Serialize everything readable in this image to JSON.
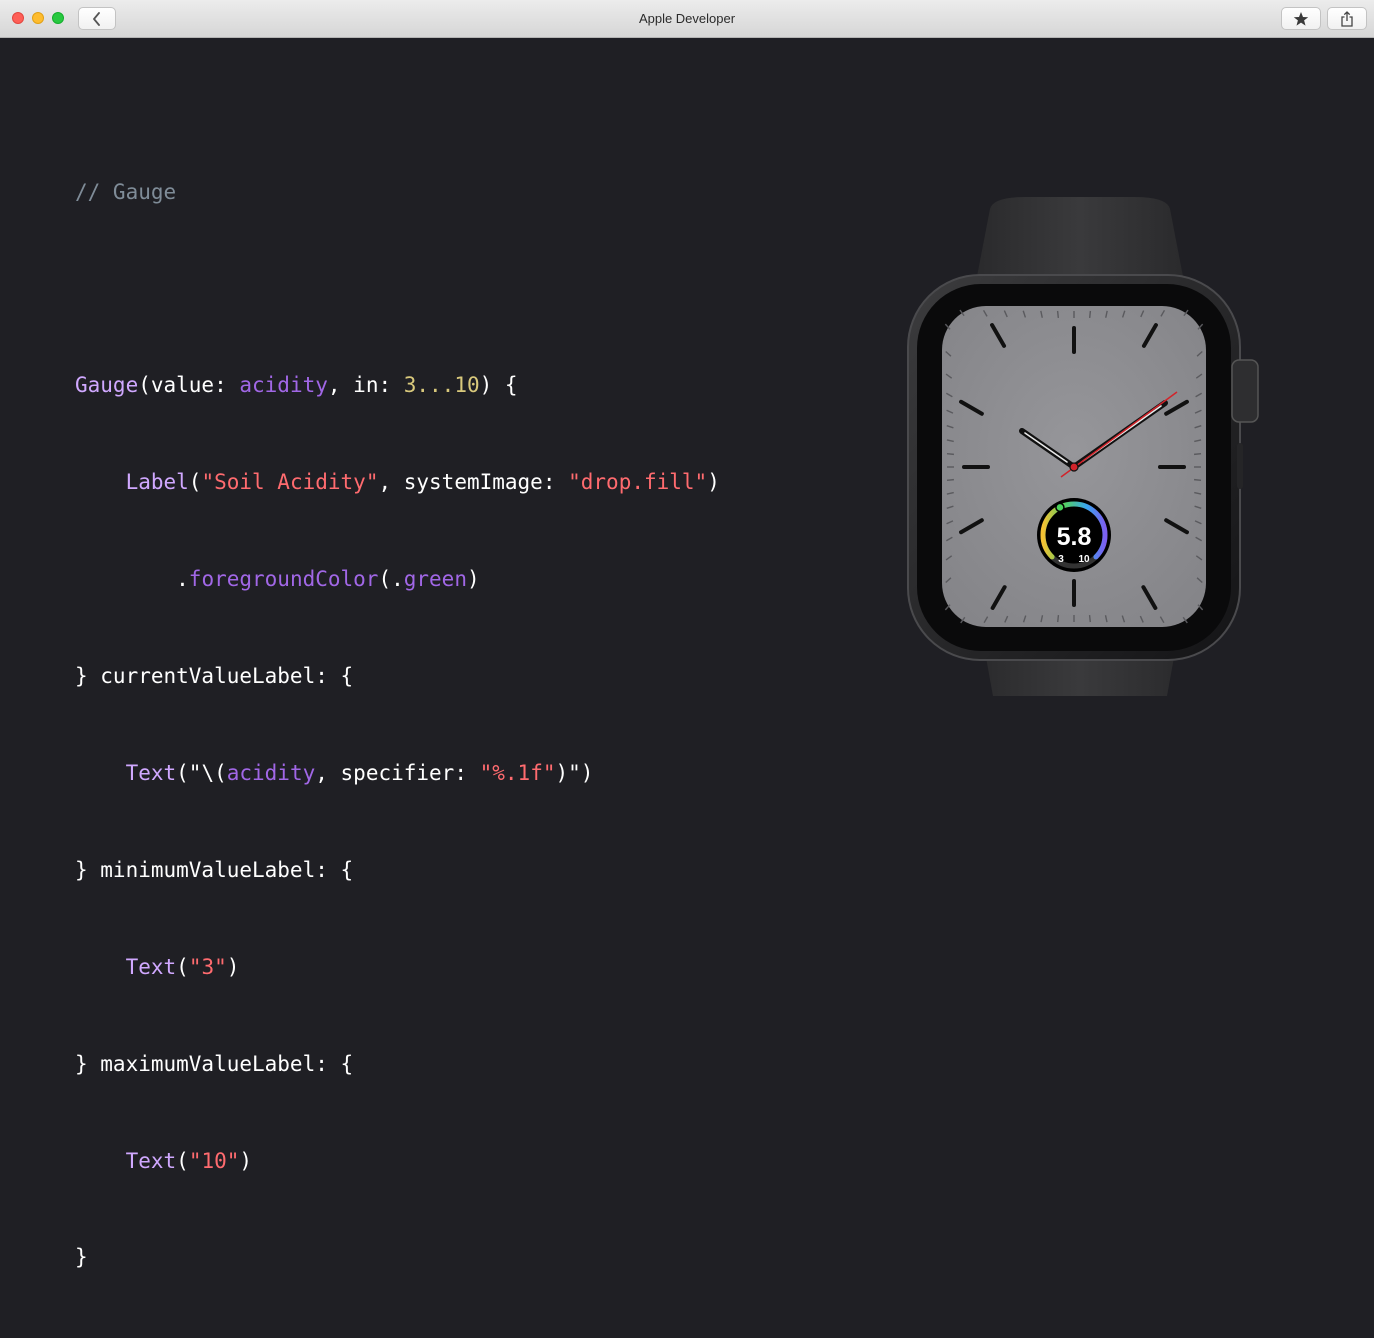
{
  "window": {
    "title": "Apple Developer",
    "controls": [
      "close",
      "minimize",
      "maximize"
    ],
    "toolbar": {
      "back_icon": "chevron-left-icon",
      "bookmark_icon": "star-icon",
      "share_icon": "share-icon"
    }
  },
  "code": {
    "comment": "// Gauge",
    "lines": [
      {
        "t1": "Gauge",
        "t2": "(value: ",
        "t3": "acidity",
        "t4": ", in: ",
        "t5": "3...10",
        "t6": ") {"
      },
      {
        "t1": "    ",
        "t2": "Label",
        "t3": "(",
        "t4": "\"Soil Acidity\"",
        "t5": ", systemImage: ",
        "t6": "\"drop.fill\"",
        "t7": ")"
      },
      {
        "t1": "        .",
        "t2": "foregroundColor",
        "t3": "(.",
        "t4": "green",
        "t5": ")"
      },
      {
        "t1": "} currentValueLabel: {"
      },
      {
        "t1": "    ",
        "t2": "Text",
        "t3": "(\"\\(",
        "t4": "acidity",
        "t5": ", specifier: ",
        "t6": "\"%.1f\"",
        "t7": ")\")"
      },
      {
        "t1": "} minimumValueLabel: {"
      },
      {
        "t1": "    ",
        "t2": "Text",
        "t3": "(",
        "t4": "\"3\"",
        "t5": ")"
      },
      {
        "t1": "} maximumValueLabel: {"
      },
      {
        "t1": "    ",
        "t2": "Text",
        "t3": "(",
        "t4": "\"10\"",
        "t5": ")"
      },
      {
        "t1": "}"
      }
    ]
  },
  "watch": {
    "gauge": {
      "current": "5.8",
      "min": "3",
      "max": "10",
      "value": 5.8,
      "range": [
        3,
        10
      ]
    }
  },
  "colors": {
    "background": "#1f1f24",
    "comment": "#7f8c98",
    "type": "#d0a8ff",
    "property": "#a167e6",
    "string": "#ff6b6f",
    "number": "#d9c97c",
    "watch_face": "#8e8e91",
    "second_hand": "#d2232a"
  }
}
